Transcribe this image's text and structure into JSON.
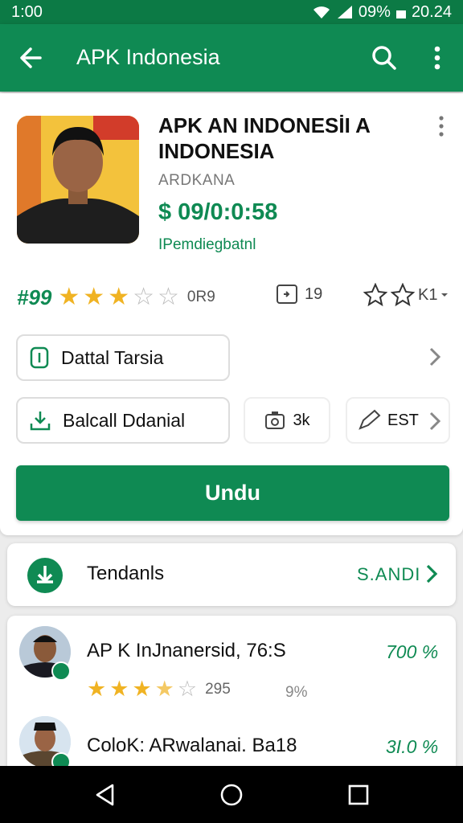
{
  "status_bar": {
    "time": "1:00",
    "battery": "09%",
    "clock_right": "20.24"
  },
  "app_bar": {
    "title": "APK Indonesia"
  },
  "app": {
    "title": "APK AN INDONESİI A INDONESIA",
    "developer": "ARDKANA",
    "price": "$ 09/0:0:58",
    "subtitle": "IPemdiegbatnl",
    "rank": "#99",
    "rating_stars": 3,
    "rating_count": "0R9",
    "downloads_count": "19",
    "share_count": "K1"
  },
  "actions": {
    "detail_label": "Dattal Tarsia",
    "install_label": "Balcall Ddanial",
    "size_label": "3k",
    "edit_label": "EST"
  },
  "download_button": {
    "label": "Undu"
  },
  "trending": {
    "label": "Tendanls",
    "more_label": "S.ANDI"
  },
  "list": [
    {
      "title": "AP K InJnanersid, 76:S",
      "price": "700 %",
      "rating_stars": 3.5,
      "rating_count": "295",
      "percent": "9%"
    },
    {
      "title": "ColoK: ARwalanai. Ba18",
      "price": "3I.0 %"
    }
  ],
  "colors": {
    "brand": "#0f8a53",
    "status_bar": "#0c7a45",
    "star": "#f0b323"
  },
  "icons": {
    "back": "arrow-left-icon",
    "search": "search-icon",
    "more": "more-vert-icon",
    "detail": "file-icon",
    "install": "download-icon",
    "size": "camera-icon",
    "edit": "pen-icon",
    "trending": "download-circle-icon"
  }
}
